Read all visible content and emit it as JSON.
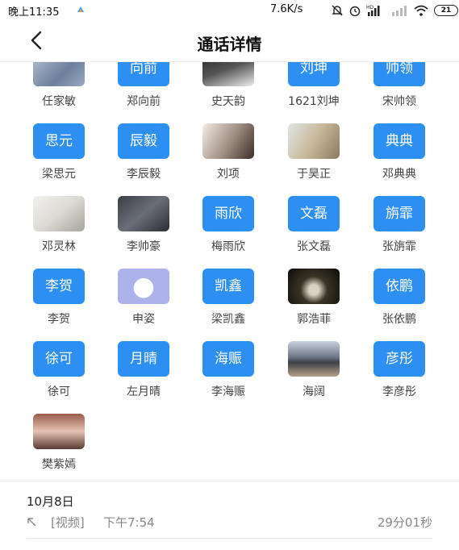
{
  "status_bar": {
    "time": "晚上11:35",
    "net_speed": "7.6K/s",
    "battery": "21",
    "icons": [
      "app-notification-icon",
      "mute-icon",
      "alarm-icon",
      "hd-signal-icon",
      "signal-icon",
      "wifi-icon",
      "battery-icon"
    ]
  },
  "header": {
    "title": "通话详情",
    "back_icon": "back-arrow-icon"
  },
  "colors": {
    "accent": "#2e8ff2",
    "text_secondary": "#888888"
  },
  "members": [
    {
      "name": "任家敏",
      "avatar_type": "photo",
      "avatar_text": ""
    },
    {
      "name": "郑向前",
      "avatar_type": "text",
      "avatar_text": "向前"
    },
    {
      "name": "史天韵",
      "avatar_type": "photo",
      "avatar_text": ""
    },
    {
      "name": "1621刘坤",
      "avatar_type": "text",
      "avatar_text": "刘坤"
    },
    {
      "name": "宋帅领",
      "avatar_type": "text",
      "avatar_text": "帅领"
    },
    {
      "name": "梁思元",
      "avatar_type": "text",
      "avatar_text": "思元"
    },
    {
      "name": "李辰毅",
      "avatar_type": "text",
      "avatar_text": "辰毅"
    },
    {
      "name": "刘项",
      "avatar_type": "photo",
      "avatar_text": ""
    },
    {
      "name": "于昊正",
      "avatar_type": "photo",
      "avatar_text": ""
    },
    {
      "name": "邓典典",
      "avatar_type": "text",
      "avatar_text": "典典"
    },
    {
      "name": "邓灵林",
      "avatar_type": "photo",
      "avatar_text": ""
    },
    {
      "name": "李帅豪",
      "avatar_type": "photo",
      "avatar_text": ""
    },
    {
      "name": "梅雨欣",
      "avatar_type": "text",
      "avatar_text": "雨欣"
    },
    {
      "name": "张文磊",
      "avatar_type": "text",
      "avatar_text": "文磊"
    },
    {
      "name": "张旃霏",
      "avatar_type": "text",
      "avatar_text": "旃霏"
    },
    {
      "name": "李贺",
      "avatar_type": "text",
      "avatar_text": "李贺"
    },
    {
      "name": "申姿",
      "avatar_type": "photo",
      "avatar_text": ""
    },
    {
      "name": "梁凯鑫",
      "avatar_type": "text",
      "avatar_text": "凯鑫"
    },
    {
      "name": "郭浩菲",
      "avatar_type": "photo",
      "avatar_text": ""
    },
    {
      "name": "张依鹏",
      "avatar_type": "text",
      "avatar_text": "依鹏"
    },
    {
      "name": "徐可",
      "avatar_type": "text",
      "avatar_text": "徐可"
    },
    {
      "name": "左月晴",
      "avatar_type": "text",
      "avatar_text": "月晴"
    },
    {
      "name": "李海赈",
      "avatar_type": "text",
      "avatar_text": "海赈"
    },
    {
      "name": "海阔",
      "avatar_type": "photo",
      "avatar_text": ""
    },
    {
      "name": "李彦彤",
      "avatar_type": "text",
      "avatar_text": "彦彤"
    },
    {
      "name": "樊紫嫣",
      "avatar_type": "photo",
      "avatar_text": ""
    }
  ],
  "history": {
    "date": "10月8日",
    "call_type": "[视频]",
    "time": "下午7:54",
    "duration": "29分01秒",
    "direction_icon": "outgoing-call-icon"
  }
}
